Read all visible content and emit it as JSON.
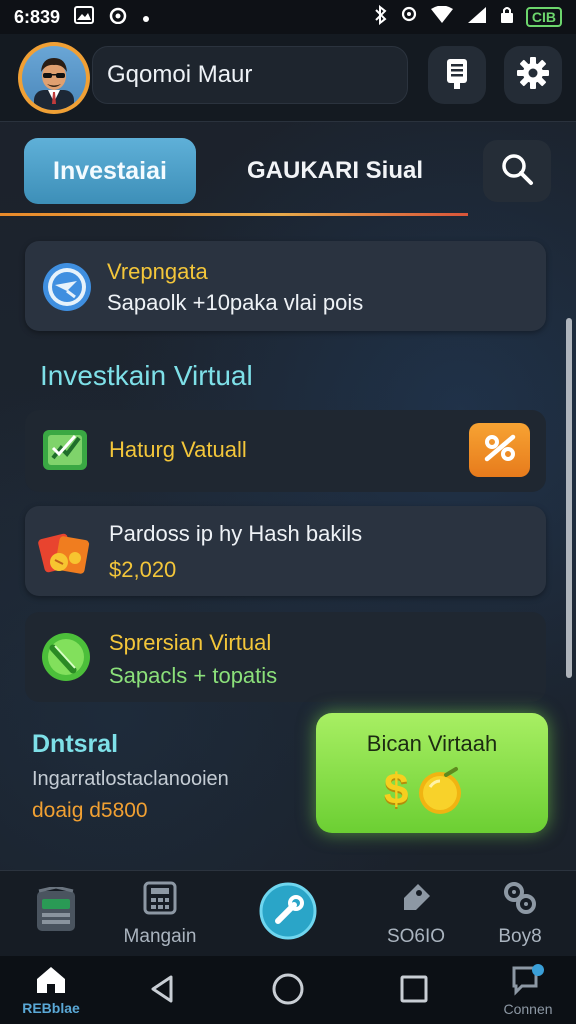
{
  "status_bar": {
    "time": "6:839",
    "battery": "CIB"
  },
  "header": {
    "user_name": "Gqomoi Maur"
  },
  "tabs": [
    {
      "label": "Investaiai",
      "active": true
    },
    {
      "label": "GAUKARI Siual",
      "active": false
    }
  ],
  "promo_card": {
    "title": "Vrepngata",
    "subtitle": "Sapaolk +10paka vlai pois"
  },
  "section_title": "Investkain Virtual",
  "items": [
    {
      "title": "Haturg Vatuall",
      "icon": "chart-check-icon",
      "action_icon": "percent-icon"
    },
    {
      "title": "Pardoss ip hy Hash bakils",
      "value": "$2,020",
      "icon": "gift-cards-icon"
    },
    {
      "title": "Sprersian Virtual",
      "subtitle": "Sapacls + topatis",
      "icon": "green-chip-icon"
    }
  ],
  "daily": {
    "title": "Dntsral",
    "subtitle": "Ingarratlostaclanooien",
    "amount": "doaig d5800"
  },
  "bonus_button": {
    "label": "Bican Virtaah",
    "symbol": "$"
  },
  "bottom_nav": [
    {
      "label": "",
      "icon": "machine-icon"
    },
    {
      "label": "Mangain",
      "icon": "calculator-icon"
    },
    {
      "label": "",
      "icon": "center-wrench-icon"
    },
    {
      "label": "SO6IO",
      "icon": "tag-icon"
    },
    {
      "label": "Boy8",
      "icon": "gear-cluster-icon"
    }
  ],
  "system_nav": {
    "home_label": "REBblae",
    "chat_label": "Connen"
  },
  "colors": {
    "accent_orange": "#e88a2a",
    "accent_blue": "#4da3cf",
    "highlight_yellow": "#f3c63a",
    "bonus_green": "#8fe04d",
    "section_cyan": "#7ee0e8"
  }
}
